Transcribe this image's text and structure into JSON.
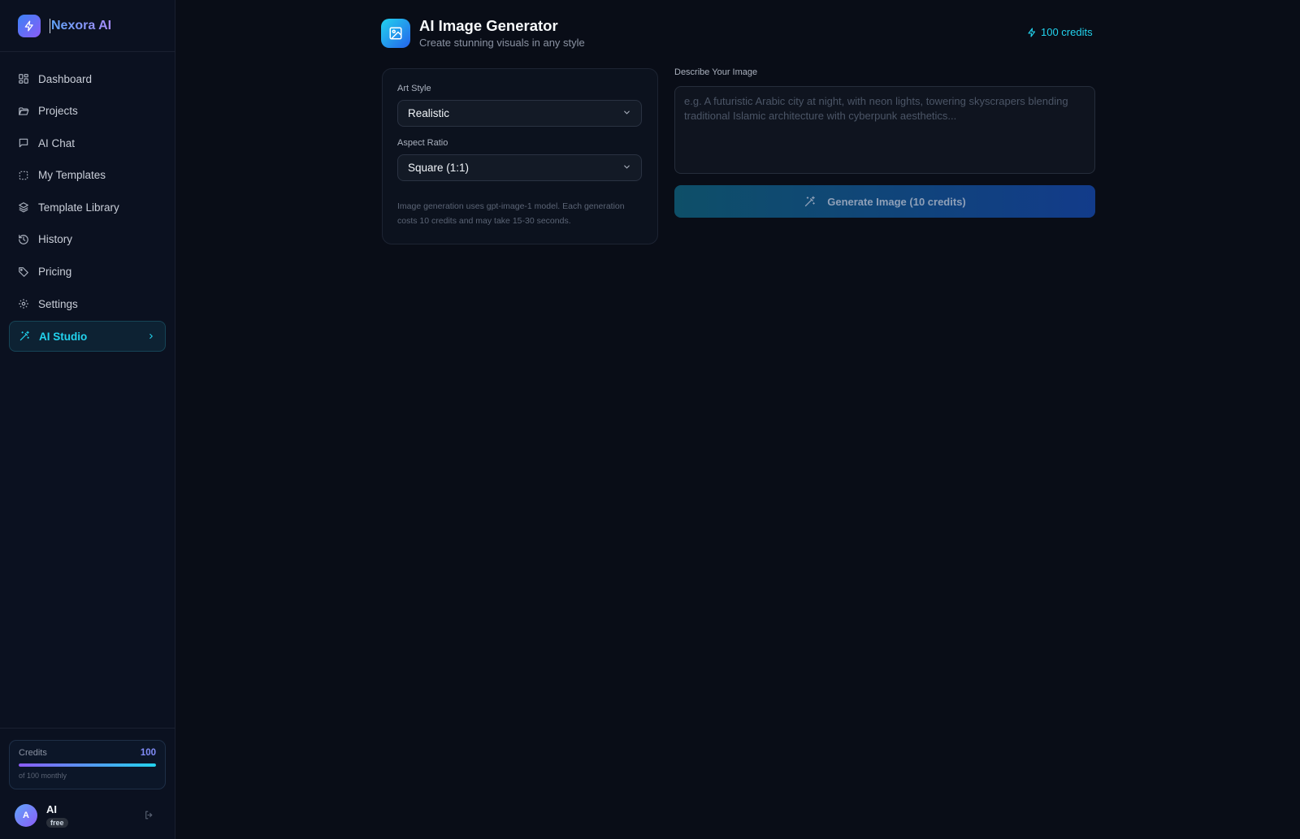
{
  "brand": {
    "name": "Nexora AI",
    "icon": "bolt-icon"
  },
  "sidebar": {
    "items": [
      {
        "label": "Dashboard",
        "icon": "dashboard-grid-icon"
      },
      {
        "label": "Projects",
        "icon": "folder-open-icon"
      },
      {
        "label": "AI Chat",
        "icon": "chat-bubble-icon"
      },
      {
        "label": "My Templates",
        "icon": "dashed-square-icon"
      },
      {
        "label": "Template Library",
        "icon": "layers-icon"
      },
      {
        "label": "History",
        "icon": "history-clock-icon"
      },
      {
        "label": "Pricing",
        "icon": "tag-icon"
      },
      {
        "label": "Settings",
        "icon": "gear-icon"
      },
      {
        "label": "AI Studio",
        "icon": "magic-wand-icon",
        "active": true
      }
    ]
  },
  "credits_card": {
    "label": "Credits",
    "value": "100",
    "sub": "of 100 monthly",
    "fraction": 1.0
  },
  "user": {
    "initial": "A",
    "name": "AI",
    "plan": "free"
  },
  "header": {
    "title": "AI Image Generator",
    "subtitle": "Create stunning visuals in any style",
    "credits": "100 credits",
    "icon": "image-icon"
  },
  "settings": {
    "art_style_label": "Art Style",
    "art_style_value": "Realistic",
    "aspect_label": "Aspect Ratio",
    "aspect_value": "Square (1:1)",
    "note": "Image generation uses gpt-image-1 model. Each generation costs 10 credits and may take 15-30 seconds."
  },
  "prompt": {
    "label": "Describe Your Image",
    "placeholder": "e.g. A futuristic Arabic city at night, with neon lights, towering skyscrapers blending traditional Islamic architecture with cyberpunk aesthetics...",
    "value": ""
  },
  "generate": {
    "label": "Generate Image (10 credits)"
  },
  "colors": {
    "background": "#090d17",
    "sidebar": "#0b1120",
    "accent_cyan": "#22d3ee",
    "accent_violet": "#8b5cf6"
  }
}
